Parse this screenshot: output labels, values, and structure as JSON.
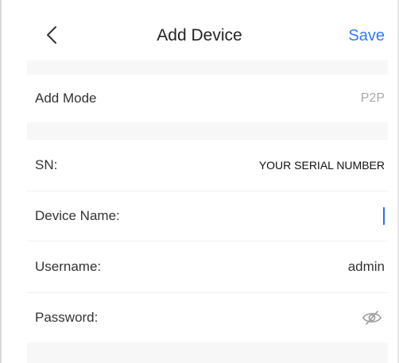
{
  "nav": {
    "back_icon": "chevron-left-icon",
    "title": "Add Device",
    "save_label": "Save"
  },
  "form": {
    "add_mode": {
      "label": "Add Mode",
      "value": "P2P"
    },
    "sn": {
      "label": "SN:",
      "value": "YOUR SERIAL NUMBER"
    },
    "device_name": {
      "label": "Device Name:",
      "value": ""
    },
    "username": {
      "label": "Username:",
      "value": "admin"
    },
    "password": {
      "label": "Password:",
      "value": "",
      "toggle_icon": "eye-off-icon"
    }
  },
  "colors": {
    "accent": "#2f7cf6",
    "cursor": "#2f6bf0",
    "section_bg": "#f7f7f7",
    "muted_text": "#a8a8a8"
  }
}
